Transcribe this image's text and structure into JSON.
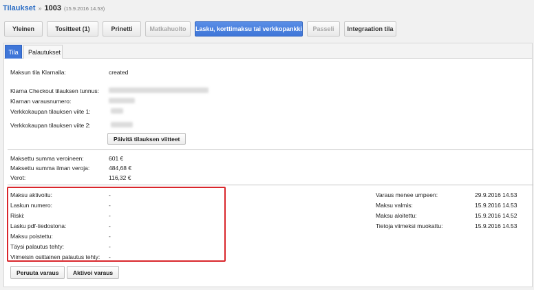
{
  "header": {
    "breadcrumb": "Tilaukset",
    "separator": "»",
    "order_number": "1003",
    "order_date": "(15.9.2016 14.53)"
  },
  "top_tabs": [
    {
      "label": "Yleinen",
      "state": "normal"
    },
    {
      "label": "Tositteet (1)",
      "state": "normal"
    },
    {
      "label": "Prinetti",
      "state": "normal"
    },
    {
      "label": "Matkahuolto",
      "state": "disabled"
    },
    {
      "label": "Lasku, korttimaksu tai verkkopankki",
      "state": "active"
    },
    {
      "label": "Passeli",
      "state": "disabled"
    },
    {
      "label": "Integraation tila",
      "state": "normal"
    }
  ],
  "sub_tabs": [
    {
      "label": "Tila",
      "active": true
    },
    {
      "label": "Palautukset",
      "active": false
    }
  ],
  "status": {
    "label": "Maksun tila Klarnalla:",
    "value": "created"
  },
  "references": {
    "checkout_id_label": "Klarna Checkout tilauksen tunnus:",
    "reservation_label": "Klarnan varausnumero:",
    "ref1_label": "Verkkokaupan tilauksen viite 1:",
    "ref2_label": "Verkkokaupan tilauksen viite 2:",
    "update_button": "Päivitä tilauksen viitteet"
  },
  "amounts": {
    "with_tax_label": "Maksettu summa veroineen:",
    "with_tax_value": "601 €",
    "without_tax_label": "Maksettu summa ilman veroja:",
    "without_tax_value": "484,68 €",
    "tax_label": "Verot:",
    "tax_value": "116,32 €"
  },
  "payment_details": [
    {
      "label": "Maksu aktivoitu:",
      "value": "-"
    },
    {
      "label": "Laskun numero:",
      "value": "-"
    },
    {
      "label": "Riski:",
      "value": "-"
    },
    {
      "label": "Lasku pdf-tiedostona:",
      "value": "-"
    },
    {
      "label": "Maksu poistettu:",
      "value": "-"
    },
    {
      "label": "Täysi palautus tehty:",
      "value": "-"
    },
    {
      "label": "Viimeisin osittainen palautus tehty:",
      "value": "-"
    }
  ],
  "timestamps": [
    {
      "label": "Varaus menee umpeen:",
      "value": "29.9.2016 14.53"
    },
    {
      "label": "Maksu valmis:",
      "value": "15.9.2016 14.53"
    },
    {
      "label": "Maksu aloitettu:",
      "value": "15.9.2016 14.52"
    },
    {
      "label": "Tietoja viimeksi muokattu:",
      "value": "15.9.2016 14.53"
    }
  ],
  "actions": {
    "cancel_button": "Peruuta varaus",
    "activate_button": "Aktivoi varaus"
  },
  "colors": {
    "accent": "#3f76d8",
    "link": "#2a6cc4",
    "highlight": "#d9262b"
  }
}
